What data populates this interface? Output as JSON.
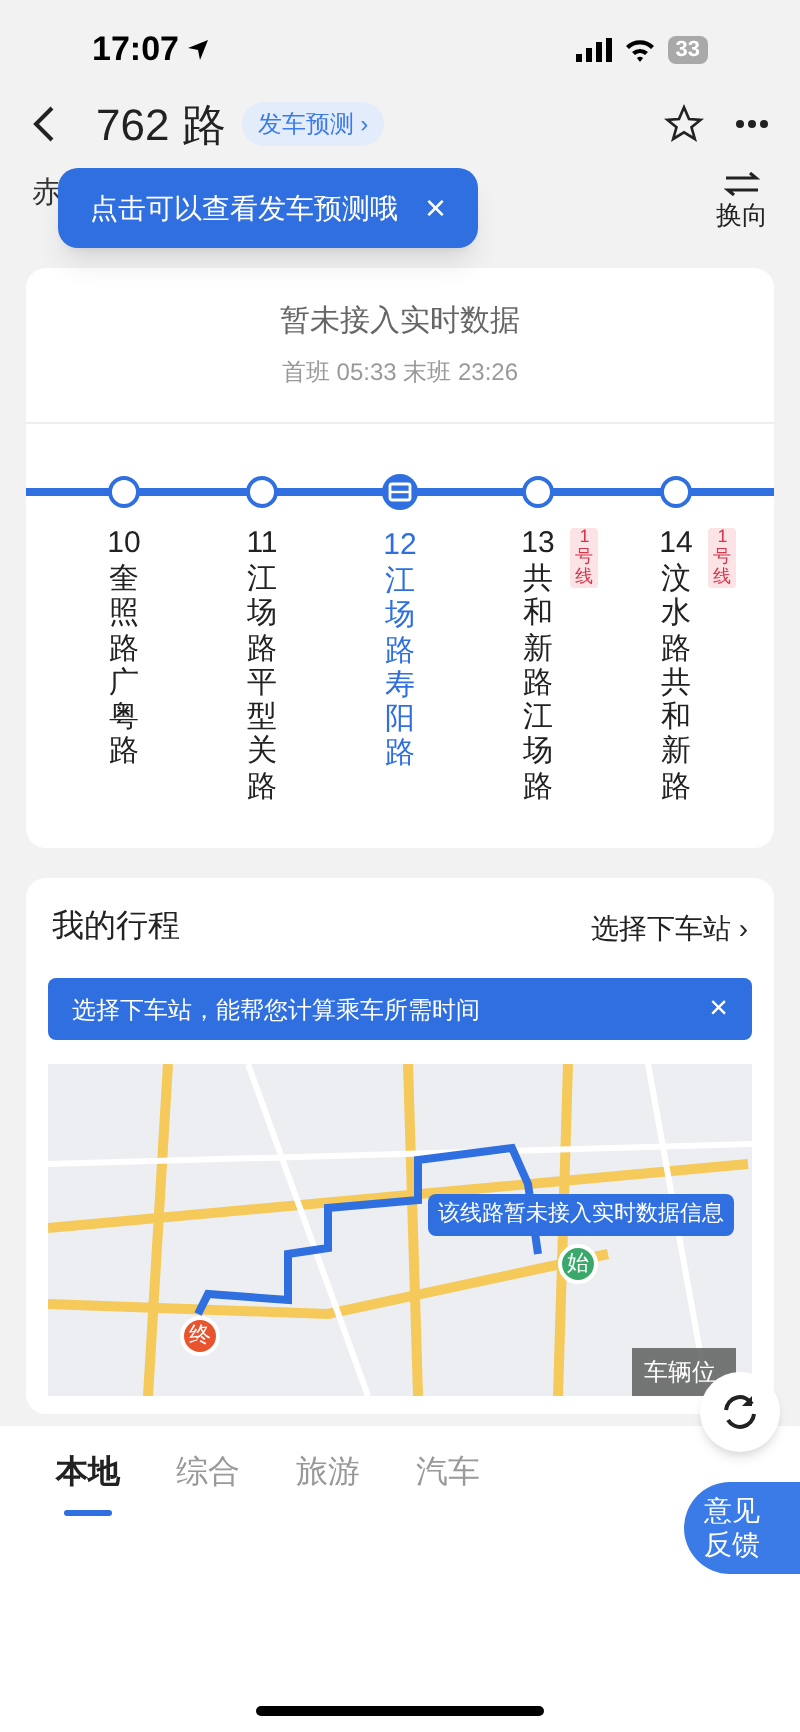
{
  "status_bar": {
    "time": "17:07",
    "battery": "33"
  },
  "header": {
    "title": "762 路",
    "forecast_chip": "发车预测",
    "chevron": "›",
    "reverse_label": "换向"
  },
  "route": {
    "from": "赤"
  },
  "tooltip": {
    "text": "点击可以查看发车预测哦",
    "close": "×"
  },
  "realtime": {
    "status": "暂未接入实时数据",
    "schedule": "首班 05:33 末班 23:26"
  },
  "stations": [
    {
      "number": "10",
      "name": "奎照路广粤路",
      "selected": false
    },
    {
      "number": "11",
      "name": "江场路平型关路",
      "selected": false
    },
    {
      "number": "12",
      "name": "江场路寿阳路",
      "selected": true
    },
    {
      "number": "13",
      "name": "共和新路江场路",
      "selected": false,
      "badge": "1号线"
    },
    {
      "number": "14",
      "name": "汶水路共和新路",
      "selected": false,
      "badge": "1号线"
    }
  ],
  "trip": {
    "title": "我的行程",
    "choose": "选择下车站",
    "chevron": "›",
    "hint": "选择下车站，能帮您计算乘车所需时间",
    "hint_close": "×"
  },
  "map": {
    "notice": "该线路暂未接入实时数据信息",
    "start": "始",
    "end": "终",
    "vehicle_position": "车辆位"
  },
  "tabs": [
    {
      "label": "本地",
      "selected": true
    },
    {
      "label": "综合",
      "selected": false
    },
    {
      "label": "旅游",
      "selected": false
    },
    {
      "label": "汽车",
      "selected": false
    }
  ],
  "feedback": "意见反馈"
}
